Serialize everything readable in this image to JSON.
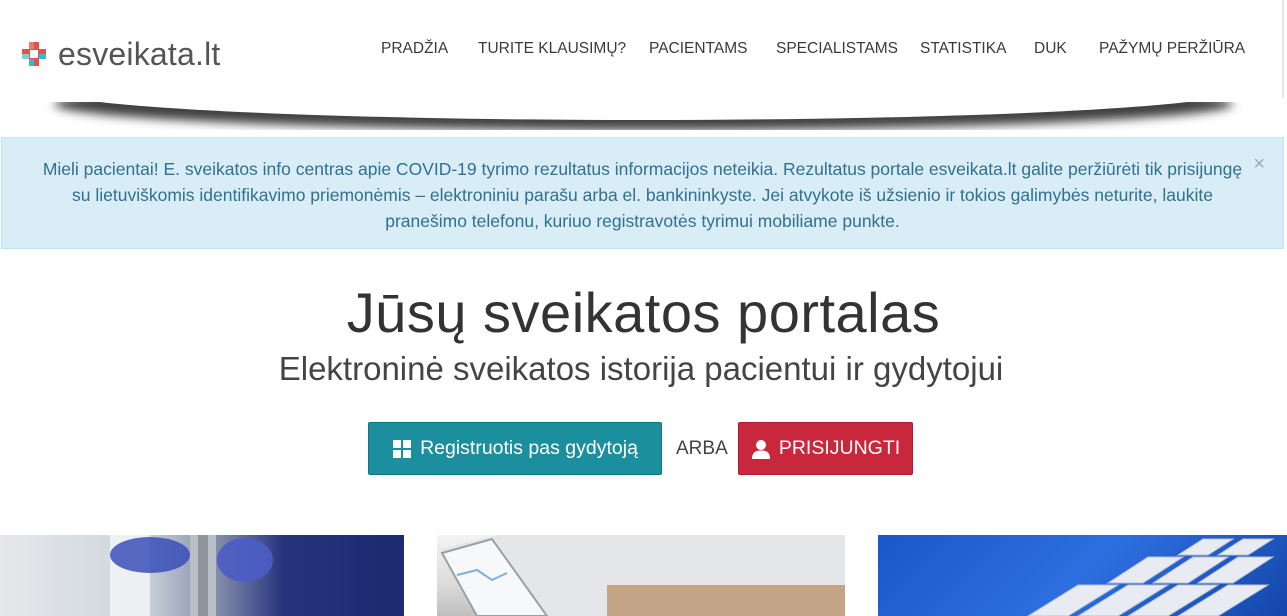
{
  "header": {
    "logo_text": "esveikata.lt",
    "nav": [
      {
        "label": "PRADŽIA"
      },
      {
        "label": "TURITE KLAUSIMŲ?"
      },
      {
        "label": "PACIENTAMS"
      },
      {
        "label": "SPECIALISTAMS"
      },
      {
        "label": "STATISTIKA"
      },
      {
        "label": "DUK"
      },
      {
        "label": "PAŽYMŲ PERŽIŪRA"
      }
    ]
  },
  "alert": {
    "text": "Mieli pacientai! E. sveikatos info centras apie COVID-19 tyrimo rezultatus informacijos neteikia. Rezultatus portale esveikata.lt galite peržiūrėti tik prisijungę su lietuviškomis identifikavimo priemonėmis – elektroniniu parašu arba el. bankininkyste. Jei atvykote iš užsienio ir tokios galimybės neturite, laukite pranešimo telefonu, kuriuo registravotės tyrimui mobiliame punkte.",
    "close_symbol": "×"
  },
  "hero": {
    "title": "Jūsų sveikatos portalas",
    "subtitle": "Elektroninė sveikatos istorija pacientui ir gydytojui",
    "register_label": "Registruotis pas gydytoją",
    "or_label": "ARBA",
    "login_label": "PRISIJUNGTI"
  },
  "colors": {
    "register_button": "#1b8f9e",
    "login_button": "#c9283c",
    "alert_bg": "#d9edf7",
    "alert_text": "#31708f"
  },
  "icons": [
    "windows-grid-icon",
    "user-icon",
    "close-icon",
    "medical-cross-logo-icon"
  ]
}
